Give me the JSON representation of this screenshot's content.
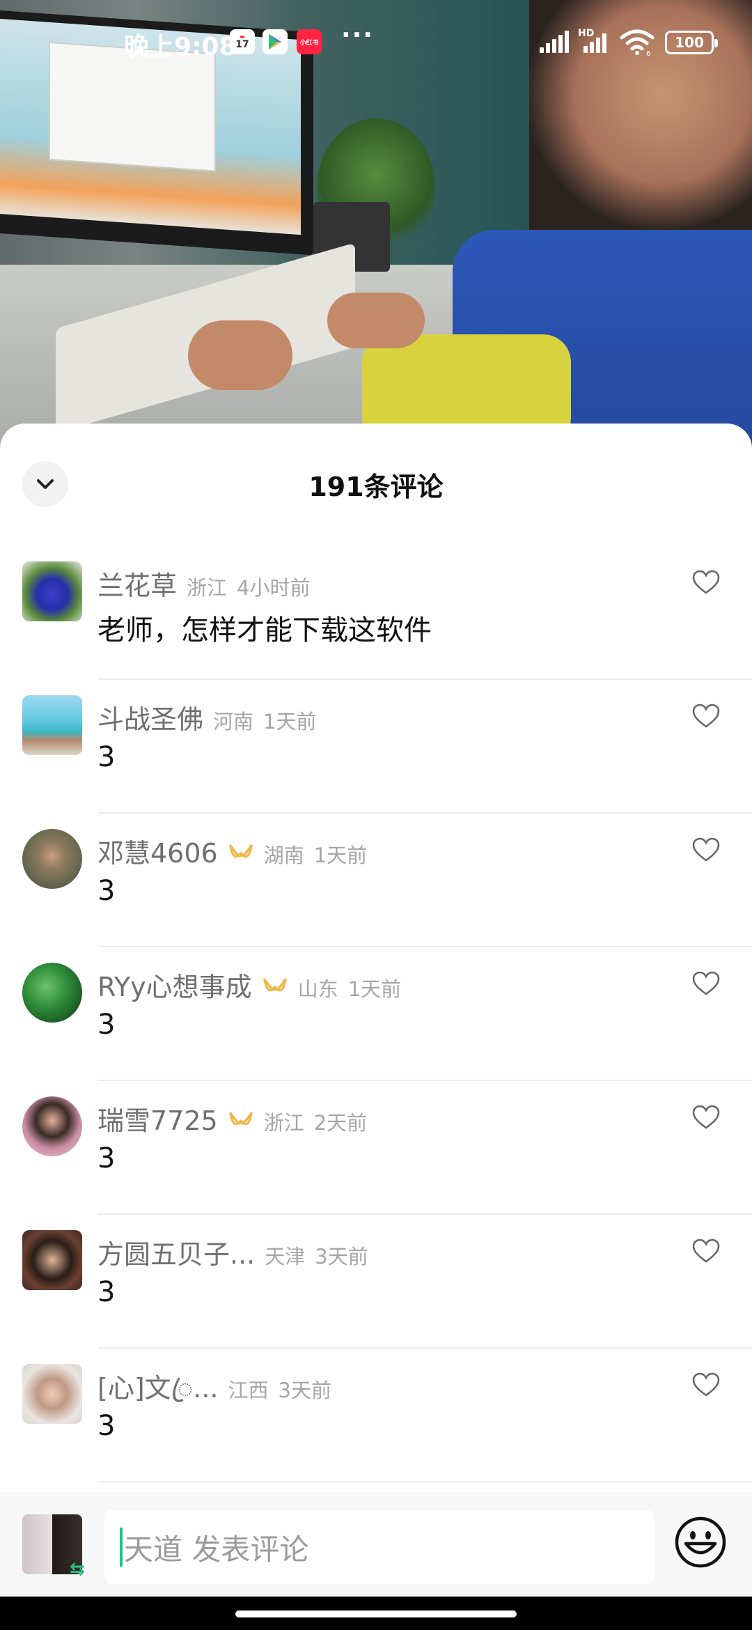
{
  "status_bar": {
    "time": "晚上9:08",
    "calendar_day": "17",
    "app_badge": "小红书",
    "more": "···",
    "network_label": "HD",
    "wifi_level": "6",
    "battery": "100"
  },
  "sheet": {
    "title": "191条评论"
  },
  "comments": [
    {
      "username": "兰花草",
      "badge": false,
      "location": "浙江",
      "time_ago": "4小时前",
      "text": "老师，怎样才能下载这软件",
      "avatar": "blue-flower"
    },
    {
      "username": "斗战圣佛",
      "badge": false,
      "location": "河南",
      "time_ago": "1天前",
      "text": "3",
      "avatar": "beach-pier"
    },
    {
      "username": "邓慧4606",
      "badge": true,
      "location": "湖南",
      "time_ago": "1天前",
      "text": "3",
      "avatar": "person-outdoor"
    },
    {
      "username": "RYy心想事成",
      "badge": true,
      "location": "山东",
      "time_ago": "1天前",
      "text": "3",
      "avatar": "green-leaves"
    },
    {
      "username": "瑞雪7725",
      "badge": true,
      "location": "浙江",
      "time_ago": "2天前",
      "text": "3",
      "avatar": "woman-flowers"
    },
    {
      "username": "方圆五贝子...",
      "badge": false,
      "location": "天津",
      "time_ago": "3天前",
      "text": "3",
      "avatar": "man-portrait"
    },
    {
      "username": "[心]文ꦿ...",
      "badge": false,
      "location": "江西",
      "time_ago": "3天前",
      "text": "3",
      "avatar": "girl-portrait"
    }
  ],
  "composer": {
    "placeholder": "天道 发表评论",
    "swap_glyph": "⇆"
  },
  "colors": {
    "accent_green": "#21c47d",
    "badge_gold": "#f0b84a",
    "muted_text": "#a6a6a6"
  }
}
